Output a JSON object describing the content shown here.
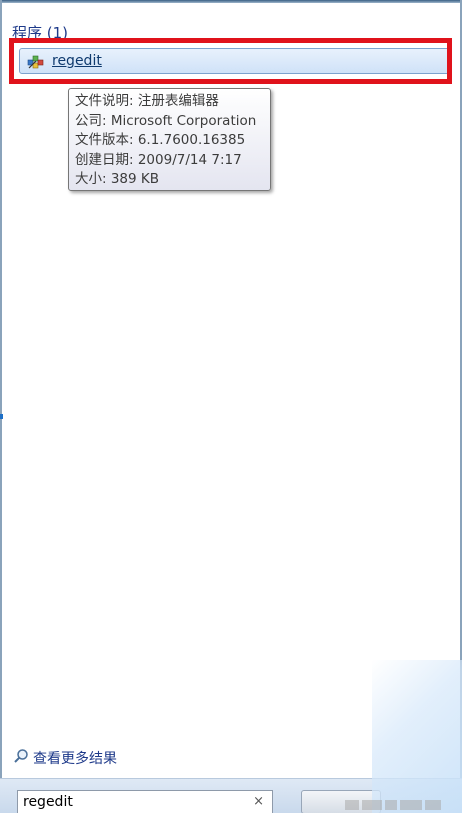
{
  "results": {
    "section_header": "程序 (1)",
    "item": {
      "label": "regedit",
      "icon": "regedit-icon"
    }
  },
  "tooltip": {
    "lines": [
      "文件说明: 注册表编辑器",
      "公司: Microsoft Corporation",
      "文件版本: 6.1.7600.16385",
      "创建日期: 2009/7/14 7:17",
      "大小: 389 KB"
    ]
  },
  "footer": {
    "see_more_label": "查看更多结果",
    "see_more_icon": "search-icon"
  },
  "search": {
    "value": "regedit",
    "clear_symbol": "×"
  },
  "colors": {
    "highlight_border": "#e0121b",
    "link": "#1e3a8a",
    "result_bg": "#cfe2f8"
  }
}
